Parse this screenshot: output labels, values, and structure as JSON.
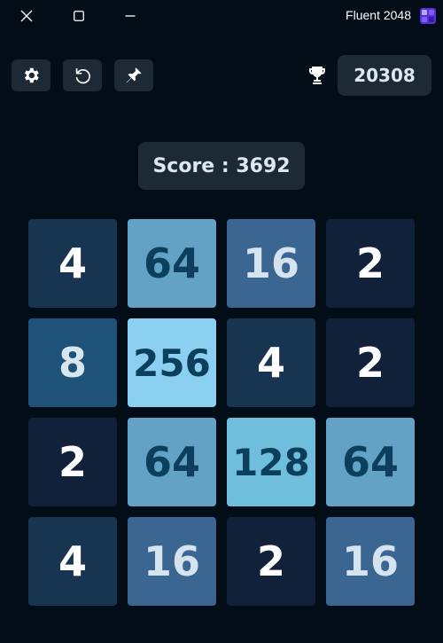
{
  "window": {
    "title": "Fluent 2048",
    "logo_icon": "app-logo-icon",
    "controls": [
      "close-icon",
      "maximize-icon",
      "minimize-icon"
    ]
  },
  "toolbar": {
    "buttons": [
      {
        "icon": "gear-icon",
        "action": "settings"
      },
      {
        "icon": "undo-icon",
        "action": "undo"
      },
      {
        "icon": "pin-icon",
        "action": "pin"
      }
    ],
    "best_icon": "trophy-icon",
    "best_score": "20308"
  },
  "score": {
    "label": "Score : 3692"
  },
  "board": {
    "rows": [
      [
        "4",
        "64",
        "16",
        "2"
      ],
      [
        "8",
        "256",
        "4",
        "2"
      ],
      [
        "2",
        "64",
        "128",
        "64"
      ],
      [
        "4",
        "16",
        "2",
        "16"
      ]
    ]
  },
  "colors": {
    "background": "#020d17",
    "panel": "#1d2a35",
    "tile_2": "#12213a",
    "tile_4": "#173551",
    "tile_8": "#1f5278",
    "tile_16": "#3b6691",
    "tile_64": "#63a2c5",
    "tile_128": "#6fbedb",
    "tile_256": "#8bd0f0",
    "dark_text": "#0b3f5b"
  }
}
